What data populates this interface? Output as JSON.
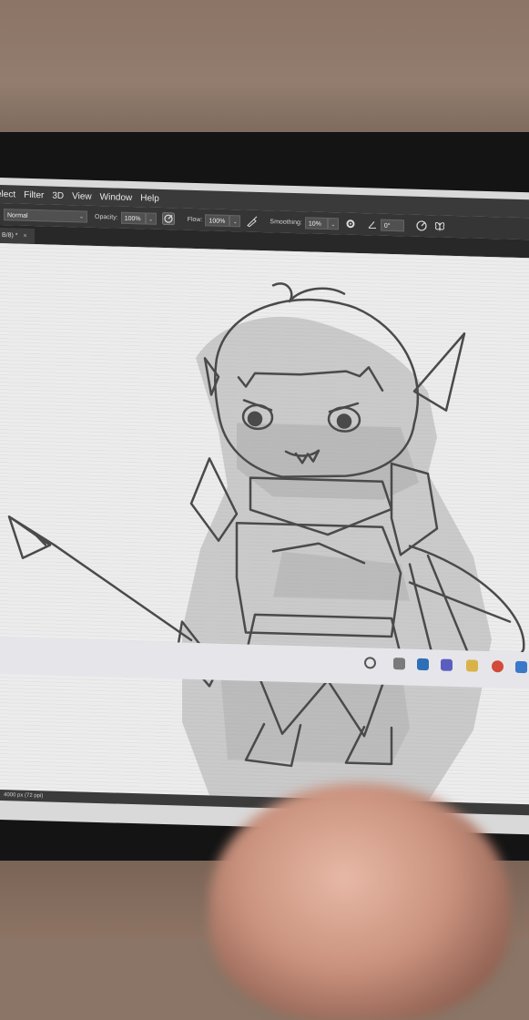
{
  "menu": {
    "items": [
      "elect",
      "Filter",
      "3D",
      "View",
      "Window",
      "Help"
    ]
  },
  "options": {
    "mode": "Normal",
    "opacity_label": "Opacity:",
    "opacity_value": "100%",
    "flow_label": "Flow:",
    "flow_value": "100%",
    "smoothing_label": "Smoothing:",
    "smoothing_value": "10%",
    "angle_value": "0°"
  },
  "tab": {
    "label": "B/8) *",
    "close": "×"
  },
  "status": {
    "text": "4000 px (72 ppi)"
  },
  "colors": {
    "menubar": "#3a3a3a",
    "optionsbar": "#353535",
    "canvas": "#ececec",
    "ink": "#4a4a4a",
    "shade": "#9a9a9a"
  },
  "icons": [
    "airbrush-icon",
    "pressure-opacity-icon",
    "gear-icon",
    "angle-icon",
    "pressure-size-icon",
    "butterfly-symmetry-icon",
    "search-icon",
    "files-icon",
    "store-icon",
    "mail-icon",
    "chrome-icon"
  ]
}
